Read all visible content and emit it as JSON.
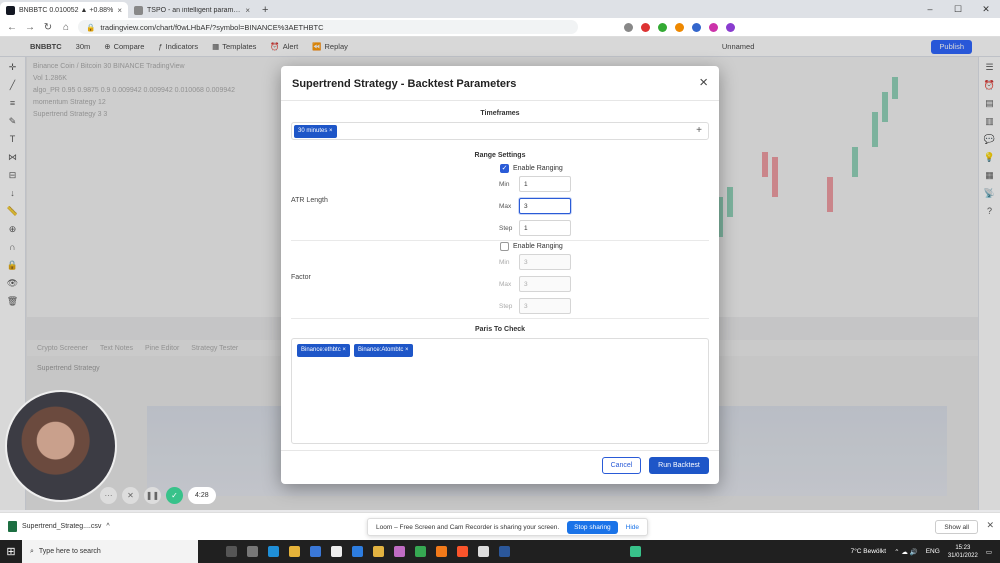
{
  "browser": {
    "tabs": [
      {
        "title": "BNBBTC 0.010052 ▲ +0.88%",
        "color": "#131722",
        "active": true
      },
      {
        "title": "TSPO - an intelligent parametr...",
        "color": "#888888",
        "active": false
      }
    ],
    "new_tab": "+",
    "url": "tradingview.com/chart/f0wLHbAF/?symbol=BINANCE%3AETHBTC"
  },
  "tv": {
    "symbol": "BNBBTC",
    "interval": "30m",
    "toolbar": [
      "Compare",
      "Indicators",
      "Templates",
      "Alert",
      "Replay"
    ],
    "unnamed": "Unnamed",
    "publish": "Publish",
    "legend": [
      "Binance Coin / Bitcoin  30  BINANCE  TradingView",
      "Vol  1.286K",
      "algo_PR 0.95 0.9875 0.9  0.009942  0.009942  0.010068  0.009942",
      "momentum Strategy 12",
      "Supertrend Strategy 3 3"
    ],
    "bottom_tabs": [
      "Crypto Screener",
      "Text Notes",
      "Pine Editor",
      "Strategy Tester"
    ],
    "strategy_selector": "Supertrend Strategy",
    "time_readout": "15:23:18 (UTC+1)"
  },
  "modal": {
    "title": "Supertrend Strategy - Backtest Parameters",
    "close": "×",
    "timeframes": {
      "label": "Timeframes",
      "tags": [
        "30 minutes ×"
      ],
      "add": "+"
    },
    "range_settings": {
      "label": "Range Settings",
      "atr": {
        "label": "ATR Length",
        "enable_label": "Enable Ranging",
        "enabled": true,
        "min_label": "Min",
        "max_label": "Max",
        "step_label": "Step",
        "min": "1",
        "max": "3",
        "step": "1"
      },
      "factor": {
        "label": "Factor",
        "enable_label": "Enable Ranging",
        "enabled": false,
        "min_label": "Min",
        "max_label": "Max",
        "step_label": "Step",
        "min": "3",
        "max": "3",
        "step": "3"
      }
    },
    "pairs": {
      "label": "Paris To Check",
      "tags": [
        "Binance:ethbtc ×",
        "Binance:Atombtc ×"
      ]
    },
    "cancel": "Cancel",
    "run": "Run Backtest"
  },
  "loom": {
    "timer": "4:28",
    "share_text": "Loom – Free Screen and Cam Recorder is sharing your screen.",
    "stop_sharing": "Stop sharing",
    "hide": "Hide"
  },
  "downloads": {
    "file": "Supertrend_Strateg....csv",
    "show_all": "Show all"
  },
  "taskbar": {
    "search_placeholder": "Type here to search",
    "weather": "7°C  Bewölkt",
    "lang": "ENG",
    "time": "15:23",
    "date": "31/01/2022"
  }
}
